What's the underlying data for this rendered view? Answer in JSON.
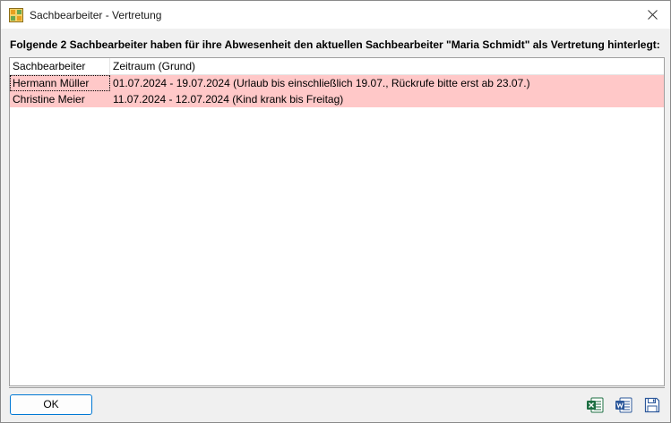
{
  "window": {
    "title": "Sachbearbeiter - Vertretung",
    "app_icon": "grid-app-icon",
    "close_icon": "close-icon"
  },
  "headline": "Folgende 2 Sachbearbeiter haben für ihre Abwesenheit den aktuellen Sachbearbeiter \"Maria Schmidt\" als Vertretung hinterlegt:",
  "table": {
    "columns": [
      "Sachbearbeiter",
      "Zeitraum (Grund)"
    ],
    "rows": [
      {
        "name": "Hermann Müller",
        "period": "01.07.2024 - 19.07.2024  (Urlaub bis einschließlich 19.07., Rückrufe bitte erst ab 23.07.)"
      },
      {
        "name": "Christine Meier",
        "period": "11.07.2024 - 12.07.2024  (Kind krank bis Freitag)"
      }
    ],
    "row_color": "#ffc8c8"
  },
  "footer": {
    "ok_label": "OK",
    "icons": [
      "excel-icon",
      "word-icon",
      "save-icon"
    ]
  },
  "colors": {
    "accent": "#0078d4",
    "excel": "#1d6f42",
    "word": "#2b579a"
  }
}
